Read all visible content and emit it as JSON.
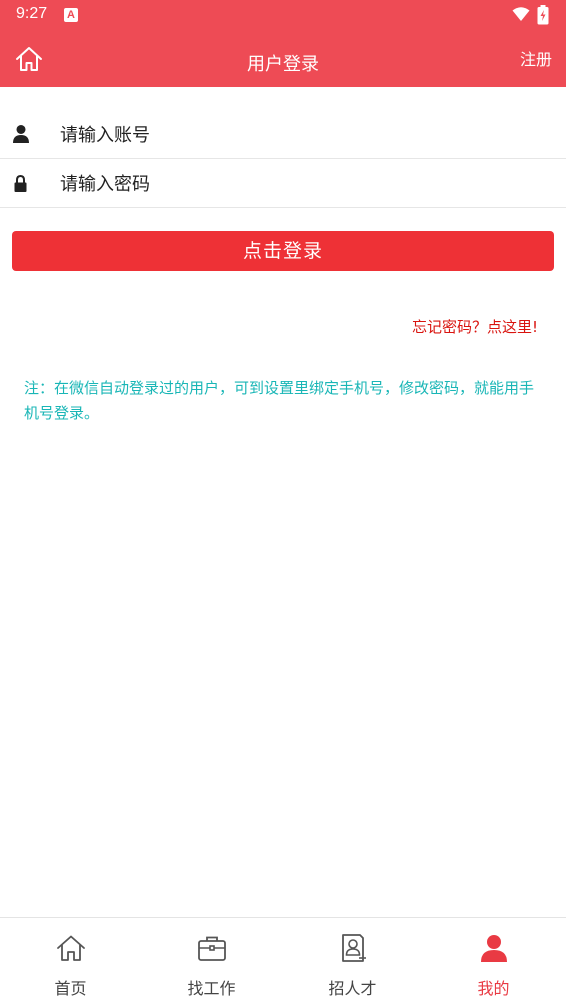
{
  "status_bar": {
    "time": "9:27",
    "notification_glyph": "A"
  },
  "header": {
    "title": "用户登录",
    "register_label": "注册"
  },
  "form": {
    "account_placeholder": "请输入账号",
    "password_placeholder": "请输入密码",
    "login_label": "点击登录",
    "forgot_label": "忘记密码？点这里!"
  },
  "note": "注：在微信自动登录过的用户，可到设置里绑定手机号，修改密码，就能用手机号登录。",
  "tabs": [
    {
      "label": "首页",
      "icon": "home-icon"
    },
    {
      "label": "找工作",
      "icon": "briefcase-icon"
    },
    {
      "label": "招人才",
      "icon": "resume-icon"
    },
    {
      "label": "我的",
      "icon": "user-icon",
      "active": true
    }
  ],
  "colors": {
    "brand": "#ee4b55",
    "button": "#ee3136",
    "link": "#d9140f",
    "note": "#19b6b6",
    "active_tab": "#e93a43"
  }
}
